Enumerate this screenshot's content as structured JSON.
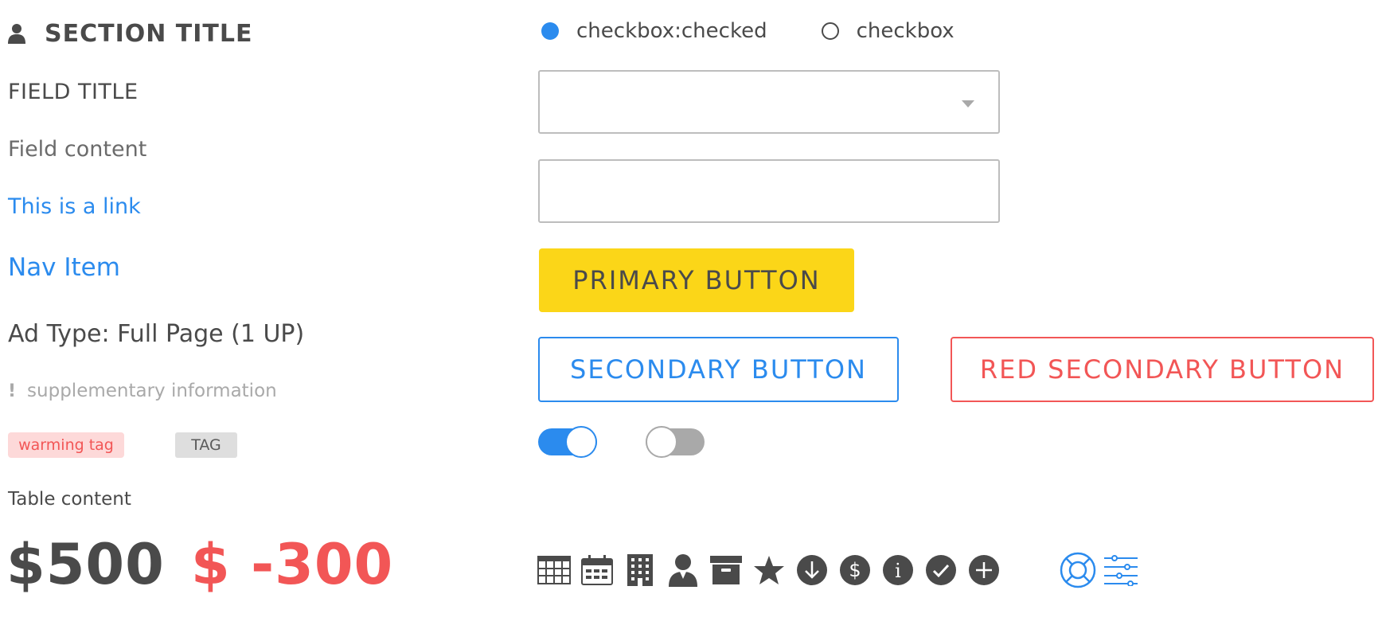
{
  "colors": {
    "text": "#4a4a4a",
    "muted": "#a9a9a9",
    "link": "#2b8bee",
    "danger": "#f25656",
    "primary_button": "#fbd618",
    "tag_warning_bg": "#fdd9d9",
    "tag_gray_bg": "#dedede",
    "border": "#bdbdbd"
  },
  "left": {
    "section_title": {
      "icon": "user-icon",
      "label": "SECTION TITLE"
    },
    "field_title": "FIELD TITLE",
    "field_content": "Field content",
    "link": "This is a link",
    "nav_item": "Nav Item",
    "ad_type": "Ad Type: Full Page (1 UP)",
    "supplementary": {
      "icon": "exclamation-icon",
      "text": "supplementary information"
    },
    "tags": {
      "warning": "warming tag",
      "default": "TAG"
    },
    "table_content": "Table content",
    "amount_positive": "$500",
    "amount_negative": "$ -300"
  },
  "right": {
    "radios": [
      {
        "label": "checkbox:checked",
        "checked": true
      },
      {
        "label": "checkbox",
        "checked": false
      }
    ],
    "select": {
      "value": "",
      "icon": "caret-down-icon"
    },
    "text_input": {
      "value": ""
    },
    "buttons": {
      "primary": "PRIMARY BUTTON",
      "secondary": "SECONDARY BUTTON",
      "red_secondary": "RED SECONDARY BUTTON"
    },
    "toggles": [
      {
        "state": "on"
      },
      {
        "state": "off"
      }
    ],
    "icons": [
      "table-icon",
      "calendar-icon",
      "building-icon",
      "user-icon",
      "archive-icon",
      "star-icon",
      "arrow-down-circle-icon",
      "dollar-circle-icon",
      "info-circle-icon",
      "check-circle-icon",
      "plus-circle-icon",
      "lifebuoy-icon",
      "sliders-icon"
    ]
  }
}
